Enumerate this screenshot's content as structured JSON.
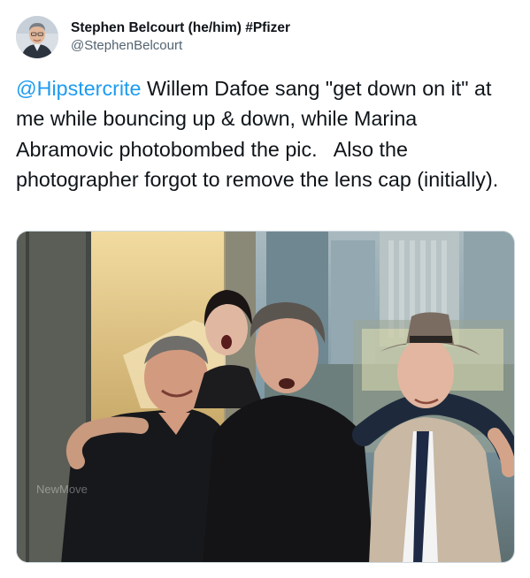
{
  "author": {
    "display_name": "Stephen Belcourt (he/him) #Pfizer",
    "handle": "@StephenBelcourt",
    "avatar_icon": "profile-photo"
  },
  "tweet": {
    "mention": "@Hipstercrite",
    "body": " Willem Dafoe sang \"get down on it\" at me while bouncing up & down, while Marina Abramovic photobombed the pic.   Also the photographer forgot to remove the lens cap (initially)."
  },
  "media": {
    "type": "photo",
    "watermark": "NewMove"
  },
  "colors": {
    "link": "#1d9bf0",
    "text": "#0f1419",
    "secondary": "#536471",
    "border": "#cfd9de"
  }
}
